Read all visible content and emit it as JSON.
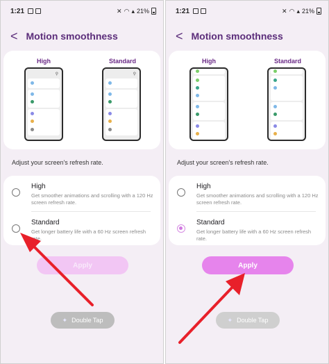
{
  "status_bar": {
    "time": "1:21",
    "battery": "21%"
  },
  "header": {
    "title": "Motion smoothness"
  },
  "preview": {
    "high_label": "High",
    "standard_label": "Standard"
  },
  "caption": "Adjust your screen's refresh rate.",
  "options": [
    {
      "title": "High",
      "desc": "Get smoother animations and scrolling with a 120 Hz screen refresh rate."
    },
    {
      "title": "Standard",
      "desc": "Get longer battery life with a 60 Hz screen refresh rate."
    }
  ],
  "apply_label": "Apply",
  "double_tap_label": "Double Tap",
  "panels": [
    {
      "selected": "standard",
      "apply_enabled": false
    },
    {
      "selected": "standard",
      "apply_enabled": true
    }
  ],
  "colors": {
    "accent": "#d079e0",
    "title": "#5b2d7a",
    "arrow": "#e8202a"
  }
}
